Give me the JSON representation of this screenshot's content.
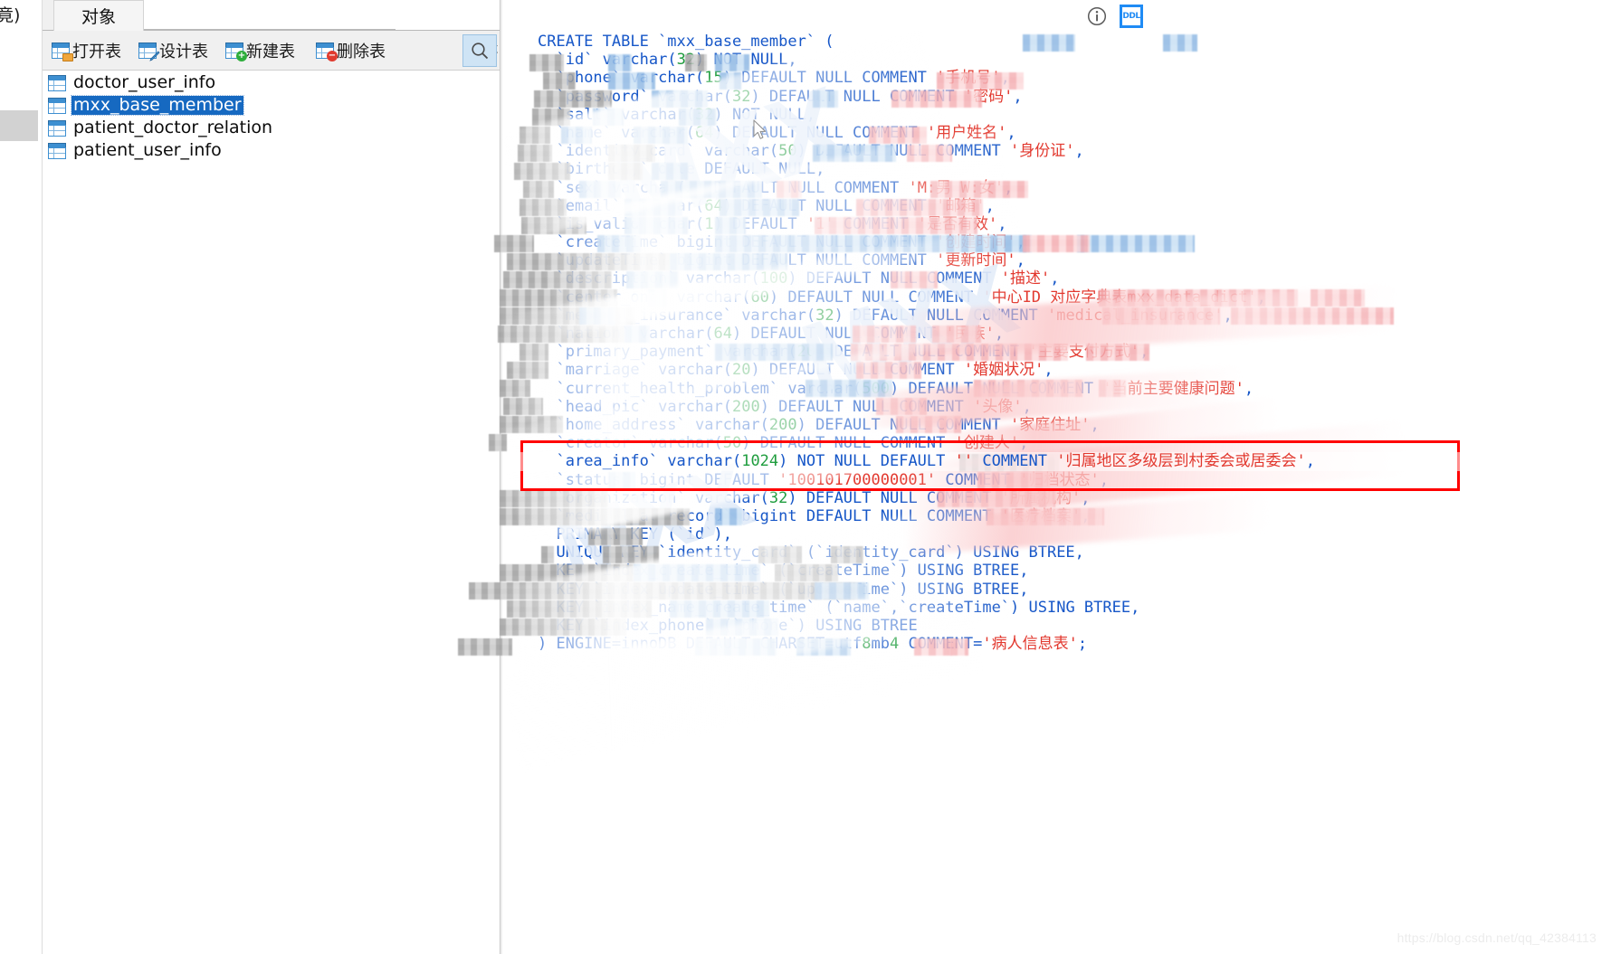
{
  "window": {
    "left_partial_text": "竟)"
  },
  "sidebar": {
    "tab_label": "对象",
    "toolbar": [
      {
        "label": "打开表",
        "icon": "table-open-icon",
        "name": "open-table-button"
      },
      {
        "label": "设计表",
        "icon": "table-design-icon",
        "name": "design-table-button"
      },
      {
        "label": "新建表",
        "icon": "table-new-icon",
        "name": "new-table-button"
      },
      {
        "label": "删除表",
        "icon": "table-delete-icon",
        "name": "delete-table-button"
      }
    ],
    "overflow_chevron": "»",
    "overflow_caret": "▼",
    "search_icon": "search-icon",
    "tables": [
      {
        "name": "doctor_user_info",
        "selected": false
      },
      {
        "name": "mxx_base_member",
        "selected": true
      },
      {
        "name": "patient_doctor_relation",
        "selected": false
      },
      {
        "name": "patient_user_info",
        "selected": false
      }
    ]
  },
  "ddl_panel": {
    "info_icon": "info-circle-icon",
    "ddl_button_label": "DDL",
    "highlight_color": "#ff0000",
    "sql_lines": [
      "CREATE TABLE `mxx_base_member` (",
      "  `id` varchar(32) NOT NULL,",
      "  `phone` varchar(15) DEFAULT NULL COMMENT '手机号',",
      "  `password` varchar(32) DEFAULT NULL COMMENT '密码',",
      "  `salt` varchar(32) NOT NULL,",
      "  `name` varchar(64) DEFAULT NULL COMMENT '用户姓名',",
      "  `identity_card` varchar(50) DEFAULT NULL COMMENT '身份证',",
      "  `birthday` date DEFAULT NULL,",
      "  `sex` varchar(2) DEFAULT NULL COMMENT 'M:男 W:女',",
      "  `email` varchar(64) DEFAULT NULL COMMENT '邮箱',",
      "  `is_valid` char(1) DEFAULT '1' COMMENT '是否有效',",
      "  `createTime` bigint DEFAULT NULL COMMENT '创建时间',",
      "  `updateTime` bigint DEFAULT NULL COMMENT '更新时间',",
      "  `description` varchar(100) DEFAULT NULL COMMENT '描述',",
      "  `center_one` varchar(60) DEFAULT NULL COMMENT '中心ID 对应字典表mxx_data_dict',",
      "  `medical_insurance` varchar(32) DEFAULT NULL COMMENT 'medical_insurance',",
      "  `nation` varchar(64) DEFAULT NULL COMMENT '民族',",
      "  `primary_payment` varchar(20) DEFAULT NULL COMMENT '主要支付方式',",
      "  `marriage` varchar(20) DEFAULT NULL COMMENT '婚姻状况',",
      "  `current_health_problem` varchar(500) DEFAULT NULL COMMENT '当前主要健康问题',",
      "  `head_pic` varchar(200) DEFAULT NULL COMMENT '头像',",
      "  `home_address` varchar(200) DEFAULT NULL COMMENT '家庭住址',",
      "  `creator` varchar(50) DEFAULT NULL COMMENT '创建人',",
      "  `area_info` varchar(1024) NOT NULL DEFAULT '' COMMENT '归属地区多级层到村委会或居委会',",
      "  `status` bigint DEFAULT '100101700000001' COMMENT '归档状态',",
      "  `organization` varchar(32) DEFAULT NULL COMMENT '所属机构',",
      "  `medical_at_record` bigint DEFAULT NULL COMMENT '医疗档案',",
      "  PRIMARY KEY (`id`),",
      "  UNIQUE KEY `identity_card` (`identity_card`) USING BTREE,",
      "  KEY `index_create_time` (`createTime`) USING BTREE,",
      "  KEY `index_update_time` (`updateTime`) USING BTREE,",
      "  KEY `index_name_create_time` (`name`,`createTime`) USING BTREE,",
      "  KEY `index_phone` (`phone`) USING BTREE",
      ") ENGINE=innoDB DEFAULT CHARSET=utf8mb4 COMMENT='病人信息表';"
    ],
    "highlighted_line_index": 23,
    "highlighted_line_text": "`area_info` varchar(1024) NOT NULL DEFAULT '' COMMENT '归属地区多级层到村委会或居委会'"
  },
  "watermark": {
    "url": "https://blog.csdn.net/qq_42384113",
    "big_text": "MXX"
  }
}
